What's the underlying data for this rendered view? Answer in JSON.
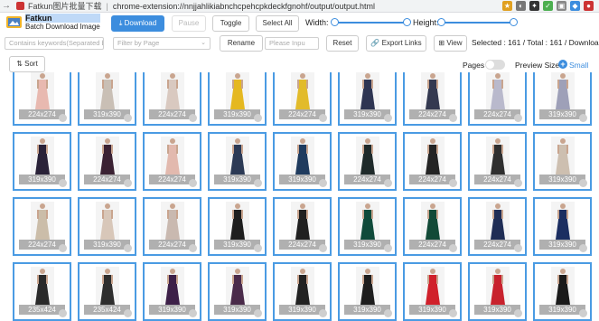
{
  "browser": {
    "tab_title": "Fatkun图片批量下载",
    "url": "chrome-extension://nnjjahlikiabnchcpehcpkdeckfgnohf/output/output.html"
  },
  "header": {
    "brand_name": "Fatkun",
    "brand_sub": "Batch Download Image",
    "download_label": "Download",
    "pause_label": "Pause",
    "toggle_label": "Toggle",
    "select_all_label": "Select All",
    "width_label": "Width:",
    "height_label": "Height:"
  },
  "filters": {
    "keywords_placeholder": "Contains keywords(Separated b",
    "page_filter_placeholder": "Filter by Page",
    "rename_label": "Rename",
    "rename_input_placeholder": "Please Inpu",
    "reset_label": "Reset",
    "export_links_label": "Export Links",
    "view_label": "View",
    "selected_status": "Selected : 161 / Total : 161 / Downloa"
  },
  "options": {
    "sort_label": "Sort",
    "pages_label": "Pages",
    "preview_size_label": "Preview Size",
    "preview_size_value": "Small"
  },
  "colors": {
    "accent": "#3c8dde",
    "tile_border": "#4a9be3"
  },
  "images": [
    {
      "dims": "224x274",
      "color": "#e8b9b0"
    },
    {
      "dims": "319x390",
      "color": "#c9bfb5"
    },
    {
      "dims": "224x274",
      "color": "#d9c9c0"
    },
    {
      "dims": "319x390",
      "color": "#e5b820"
    },
    {
      "dims": "224x274",
      "color": "#e2bb2a"
    },
    {
      "dims": "319x390",
      "color": "#2e3552"
    },
    {
      "dims": "224x274",
      "color": "#343950"
    },
    {
      "dims": "224x274",
      "color": "#b9b9cc"
    },
    {
      "dims": "319x390",
      "color": "#9ea0b8"
    },
    {
      "dims": "319x390",
      "color": "#2a2238"
    },
    {
      "dims": "224x274",
      "color": "#3b2233"
    },
    {
      "dims": "224x274",
      "color": "#e2b9ae"
    },
    {
      "dims": "319x390",
      "color": "#2c3a55"
    },
    {
      "dims": "319x390",
      "color": "#1f3b5e"
    },
    {
      "dims": "224x274",
      "color": "#1f2a2a"
    },
    {
      "dims": "224x274",
      "color": "#242424"
    },
    {
      "dims": "224x274",
      "color": "#2f2f2f"
    },
    {
      "dims": "319x390",
      "color": "#cdbfb0"
    },
    {
      "dims": "224x274",
      "color": "#cbbda9"
    },
    {
      "dims": "319x390",
      "color": "#d8c7b9"
    },
    {
      "dims": "224x274",
      "color": "#c9b9b0"
    },
    {
      "dims": "319x390",
      "color": "#1f1f1f"
    },
    {
      "dims": "224x274",
      "color": "#202020"
    },
    {
      "dims": "319x390",
      "color": "#0f4a3a"
    },
    {
      "dims": "224x274",
      "color": "#124a37"
    },
    {
      "dims": "224x274",
      "color": "#1f2d55"
    },
    {
      "dims": "319x390",
      "color": "#1b2e61"
    },
    {
      "dims": "235x424",
      "color": "#2a2a2a"
    },
    {
      "dims": "235x424",
      "color": "#2e2e2e"
    },
    {
      "dims": "319x390",
      "color": "#3d2048"
    },
    {
      "dims": "319x390",
      "color": "#4a2b4a"
    },
    {
      "dims": "319x390",
      "color": "#222222"
    },
    {
      "dims": "319x390",
      "color": "#1e1e1e"
    },
    {
      "dims": "319x390",
      "color": "#d0202a"
    },
    {
      "dims": "319x390",
      "color": "#c8222d"
    },
    {
      "dims": "319x390",
      "color": "#1a1a1a"
    }
  ]
}
